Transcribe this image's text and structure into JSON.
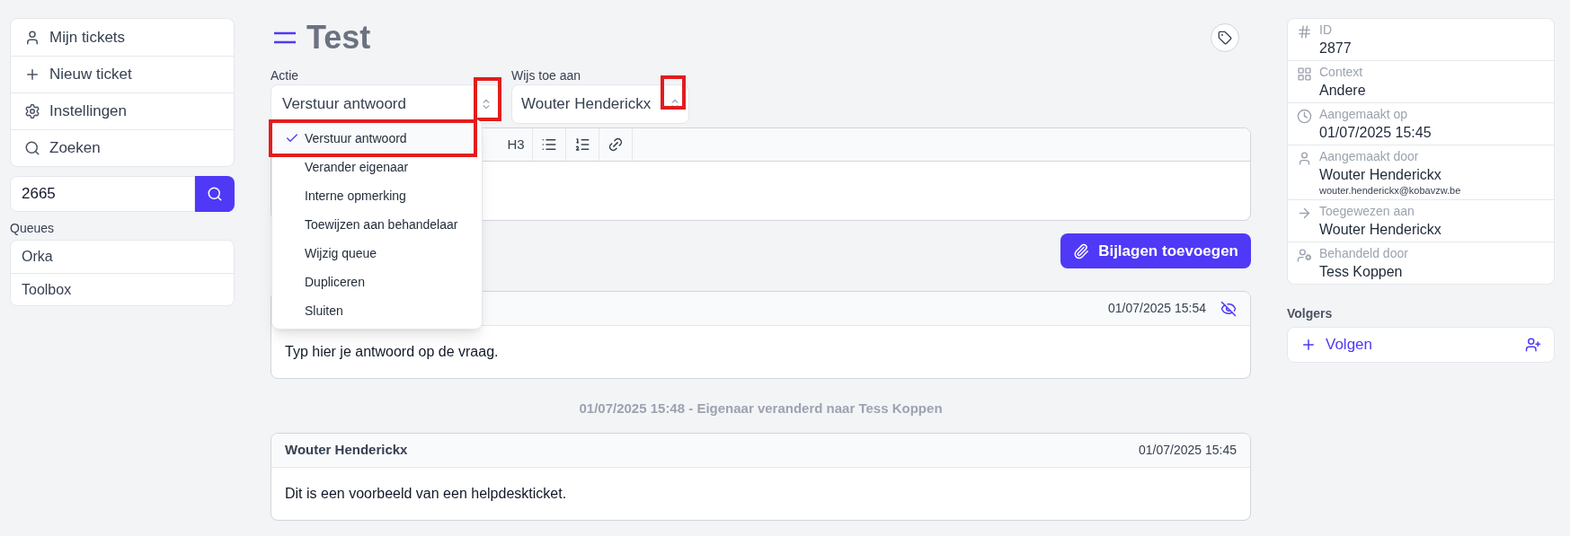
{
  "sidebar": {
    "nav": [
      {
        "kind": "user",
        "label": "Mijn tickets"
      },
      {
        "kind": "plus",
        "label": "Nieuw ticket"
      },
      {
        "kind": "gear",
        "label": "Instellingen"
      },
      {
        "kind": "search",
        "label": "Zoeken"
      }
    ],
    "search": {
      "value": "2665"
    },
    "queues_label": "Queues",
    "queues": [
      "Orka",
      "Toolbox"
    ]
  },
  "title": "Test",
  "action": {
    "label": "Actie",
    "value": "Verstuur antwoord",
    "highlighted": true,
    "options": [
      {
        "label": "Verstuur antwoord",
        "selected": true,
        "highlighted": true
      },
      {
        "label": "Verander eigenaar",
        "selected": false,
        "highlighted": false
      },
      {
        "label": "Interne opmerking",
        "selected": false,
        "highlighted": false
      },
      {
        "label": "Toewijzen aan behandelaar",
        "selected": false,
        "highlighted": false
      },
      {
        "label": "Wijzig queue",
        "selected": false,
        "highlighted": false
      },
      {
        "label": "Dupliceren",
        "selected": false,
        "highlighted": false
      },
      {
        "label": "Sluiten",
        "selected": false,
        "highlighted": false
      }
    ]
  },
  "assign": {
    "label": "Wijs toe aan",
    "value": "Wouter Henderickx",
    "highlighted": true
  },
  "toolbar": [
    {
      "kind": "text",
      "label": "H3"
    },
    {
      "kind": "bullets"
    },
    {
      "kind": "numbers"
    },
    {
      "kind": "link"
    }
  ],
  "attach_button": "Bijlagen toevoegen",
  "timeline": [
    {
      "kind": "message",
      "time": "01/07/2025 15:54",
      "hidden": true,
      "body": "Typ hier je antwoord op de vraag."
    },
    {
      "kind": "event",
      "text": "01/07/2025 15:48 - Eigenaar veranderd naar Tess Koppen"
    },
    {
      "kind": "message",
      "author": "Wouter Henderickx",
      "time": "01/07/2025 15:45",
      "hidden": false,
      "body": "Dit is een voorbeeld van een helpdeskticket."
    }
  ],
  "details": [
    {
      "kind": "hash",
      "label": "ID",
      "value": "2877"
    },
    {
      "kind": "grid",
      "label": "Context",
      "value": "Andere"
    },
    {
      "kind": "clock",
      "label": "Aangemaakt op",
      "value": "01/07/2025 15:45"
    },
    {
      "kind": "user",
      "label": "Aangemaakt door",
      "value": "Wouter Henderickx",
      "sub": "wouter.henderickx@kobavzw.be"
    },
    {
      "kind": "arrow",
      "label": "Toegewezen aan",
      "value": "Wouter Henderickx"
    },
    {
      "kind": "usergear",
      "label": "Behandeld door",
      "value": "Tess Koppen"
    }
  ],
  "followers": {
    "label": "Volgers",
    "button": "Volgen"
  }
}
